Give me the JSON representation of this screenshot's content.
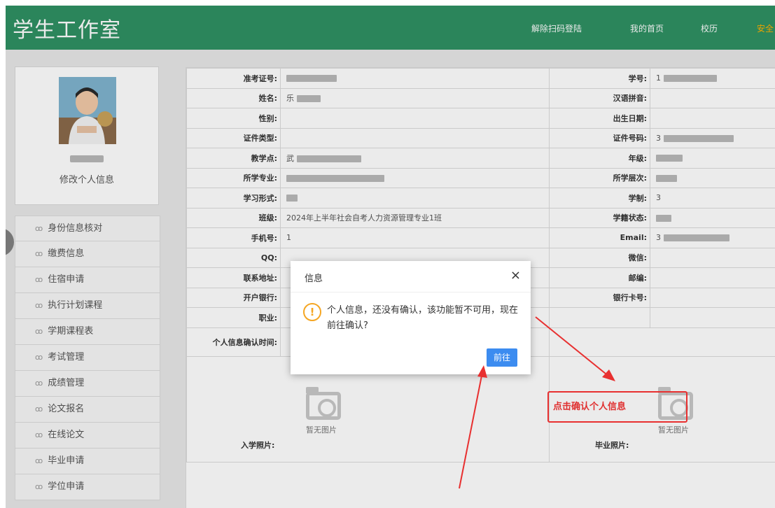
{
  "header": {
    "brand": "学生工作室",
    "nav": [
      "解除扫码登陆",
      "我的首页",
      "校历",
      "安全"
    ]
  },
  "profile": {
    "edit_label": "修改个人信息"
  },
  "menu": {
    "icon": "link-icon",
    "icon_glyph": "ꝏ",
    "items": [
      "身份信息核对",
      "缴费信息",
      "住宿申请",
      "执行计划课程",
      "学期课程表",
      "考试管理",
      "成绩管理",
      "论文报名",
      "在线论文",
      "毕业申请",
      "学位申请"
    ]
  },
  "info": {
    "rows": [
      {
        "l1": "准考证号:",
        "v1": "",
        "l2": "学号:",
        "v2": "1"
      },
      {
        "l1": "姓名:",
        "v1": "乐",
        "l2": "汉语拼音:",
        "v2": ""
      },
      {
        "l1": "性别:",
        "v1": "",
        "l2": "出生日期:",
        "v2": ""
      },
      {
        "l1": "证件类型:",
        "v1": "",
        "l2": "证件号码:",
        "v2": "3"
      },
      {
        "l1": "教学点:",
        "v1": "武",
        "l2": "年级:",
        "v2": ""
      },
      {
        "l1": "所学专业:",
        "v1": "",
        "l2": "所学层次:",
        "v2": ""
      },
      {
        "l1": "学习形式:",
        "v1": "",
        "l2": "学制:",
        "v2": "3"
      },
      {
        "l1": "班级:",
        "v1": "2024年上半年社会自考人力资源管理专业1班",
        "l2": "学籍状态:",
        "v2": ""
      },
      {
        "l1": "手机号:",
        "v1": "1",
        "l2": "Email:",
        "v2": "3"
      },
      {
        "l1": "QQ:",
        "v1": "",
        "l2": "微信:",
        "v2": ""
      },
      {
        "l1": "联系地址:",
        "v1": "",
        "l2": "邮编:",
        "v2": ""
      },
      {
        "l1": "开户银行:",
        "v1": "",
        "l2": "银行卡号:",
        "v2": ""
      },
      {
        "l1": "职业:",
        "v1": "",
        "l2": "",
        "v2": ""
      }
    ],
    "confirm_time_label": "个人信息确认时间:",
    "photo_placeholder": "暂无图片",
    "entry_photo_label": "入学照片:",
    "grad_photo_label": "毕业照片:"
  },
  "dialog": {
    "title": "信息",
    "close": "×",
    "icon": "!",
    "message": "个人信息，还没有确认，该功能暂不可用，现在前往确认?",
    "button": "前往"
  },
  "annotation": {
    "text": "点击确认个人信息",
    "color": "#e83030"
  },
  "colors": {
    "header_bg": "#2f9163",
    "dialog_button": "#3c8cf0",
    "warning": "#f5a623"
  }
}
